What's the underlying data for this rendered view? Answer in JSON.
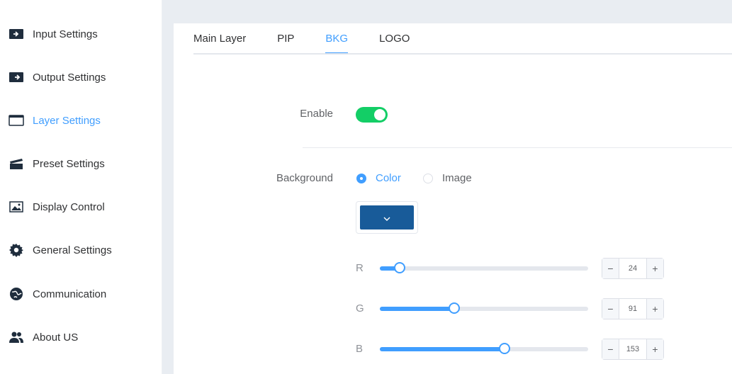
{
  "sidebar": {
    "items": [
      {
        "label": "Input Settings",
        "icon": "input-icon",
        "active": false
      },
      {
        "label": "Output Settings",
        "icon": "output-icon",
        "active": false
      },
      {
        "label": "Layer Settings",
        "icon": "layer-icon",
        "active": true
      },
      {
        "label": "Preset Settings",
        "icon": "clapperboard-icon",
        "active": false
      },
      {
        "label": "Display Control",
        "icon": "image-icon",
        "active": false
      },
      {
        "label": "General Settings",
        "icon": "gear-icon",
        "active": false
      },
      {
        "label": "Communication",
        "icon": "globe-icon",
        "active": false
      },
      {
        "label": "About US",
        "icon": "users-icon",
        "active": false
      }
    ]
  },
  "tabs": [
    {
      "label": "Main Layer",
      "active": false
    },
    {
      "label": "PIP",
      "active": false
    },
    {
      "label": "BKG",
      "active": true
    },
    {
      "label": "LOGO",
      "active": false
    }
  ],
  "form": {
    "enable_label": "Enable",
    "enable_value": true,
    "background_label": "Background",
    "background_options": [
      {
        "label": "Color",
        "checked": true
      },
      {
        "label": "Image",
        "checked": false
      }
    ],
    "color_value": "#185b99",
    "channels": [
      {
        "label": "R",
        "value": "24",
        "max": 255
      },
      {
        "label": "G",
        "value": "91",
        "max": 255
      },
      {
        "label": "B",
        "value": "153",
        "max": 255
      }
    ],
    "minus_symbol": "−",
    "plus_symbol": "+"
  },
  "colors": {
    "accent": "#409eff",
    "switch_on": "#13ce66"
  }
}
